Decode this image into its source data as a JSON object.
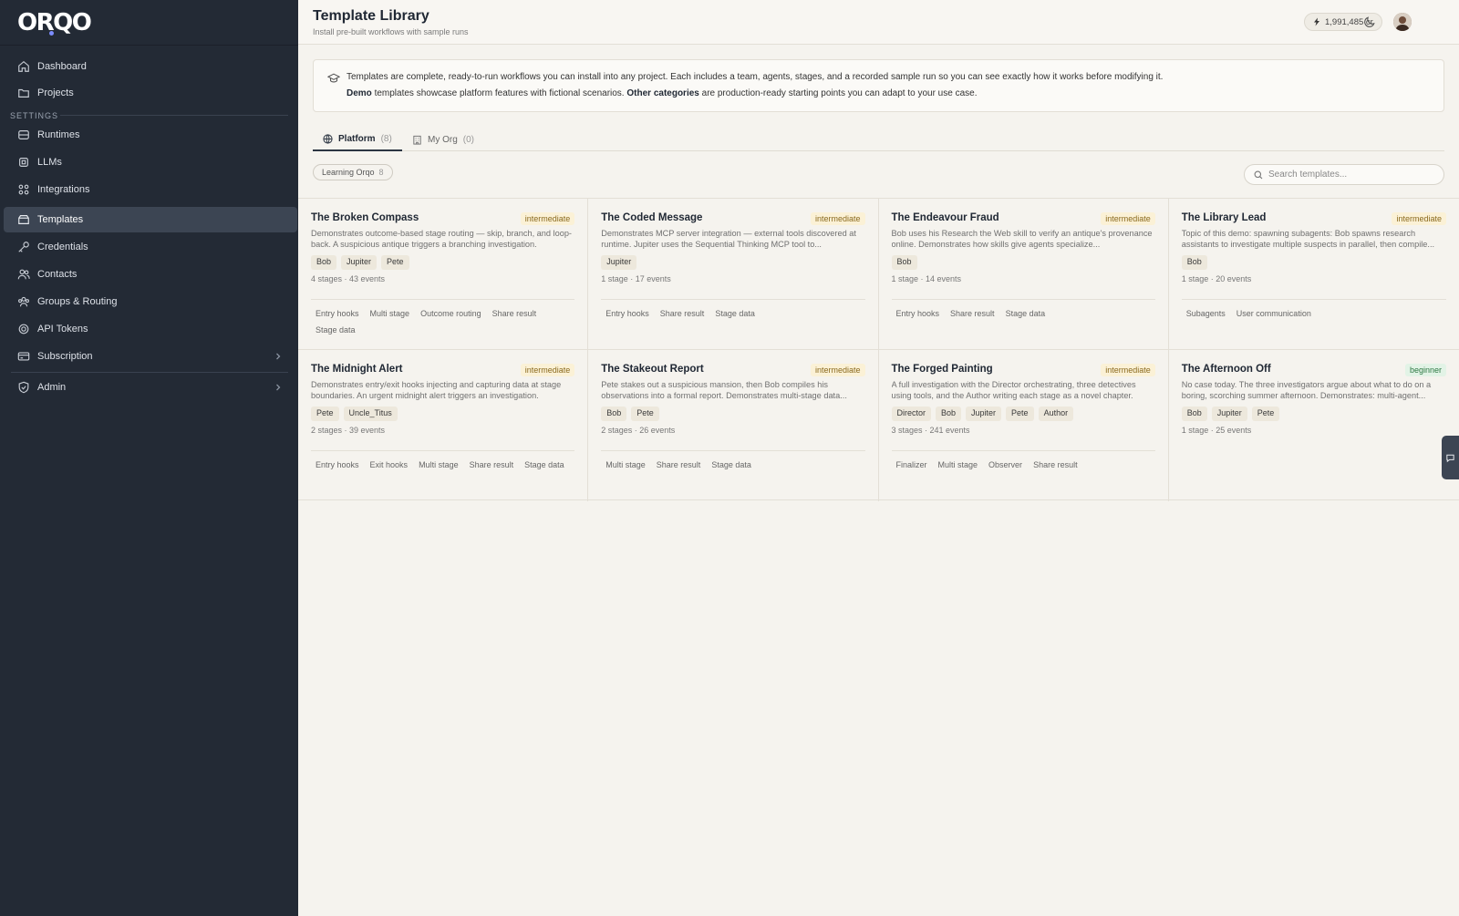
{
  "brand": {
    "logo_text": "ORQO"
  },
  "sidebar": {
    "items_top": [
      {
        "label": "Dashboard",
        "icon": "home-icon"
      },
      {
        "label": "Projects",
        "icon": "folder-icon"
      }
    ],
    "section_label": "SETTINGS",
    "items_settings": [
      {
        "label": "Runtimes",
        "icon": "database-icon"
      },
      {
        "label": "LLMs",
        "icon": "chip-icon"
      },
      {
        "label": "Integrations",
        "icon": "grid-icon"
      },
      {
        "label": "Templates",
        "icon": "box-icon",
        "active": true
      },
      {
        "label": "Credentials",
        "icon": "key-icon"
      },
      {
        "label": "Contacts",
        "icon": "users-icon"
      },
      {
        "label": "Groups & Routing",
        "icon": "group-icon"
      },
      {
        "label": "API Tokens",
        "icon": "token-icon"
      },
      {
        "label": "Subscription",
        "icon": "card-icon",
        "chevron": true
      }
    ],
    "admin": {
      "label": "Admin",
      "icon": "shield-icon",
      "chevron": true
    }
  },
  "header": {
    "title": "Template Library",
    "subtitle": "Install pre-built workflows with sample runs",
    "credits": "1,991,485 cr"
  },
  "banner": {
    "line1": "Templates are complete, ready-to-run workflows you can install into any project. Each includes a team, agents, stages, and a recorded sample run so you can see exactly how it works before modifying it.",
    "line2_bold1": "Demo",
    "line2_text1": " templates showcase platform features with fictional scenarios. ",
    "line2_bold2": "Other categories",
    "line2_text2": " are production-ready starting points you can adapt to your use case."
  },
  "tabs": [
    {
      "label": "Platform",
      "count": "(8)",
      "active": true
    },
    {
      "label": "My Org",
      "count": "(0)",
      "active": false
    }
  ],
  "filter": {
    "label": "Learning Orqo",
    "count": "8"
  },
  "search": {
    "placeholder": "Search templates..."
  },
  "cards": [
    {
      "title": "The Broken Compass",
      "level": "intermediate",
      "desc": "Demonstrates outcome-based stage routing — skip, branch, and loop-back. A suspicious antique triggers a branching investigation.",
      "agents": [
        "Bob",
        "Jupiter",
        "Pete"
      ],
      "stats": "4 stages · 43 events",
      "features": [
        "Entry hooks",
        "Multi stage",
        "Outcome routing",
        "Share result",
        "Stage data"
      ]
    },
    {
      "title": "The Coded Message",
      "level": "intermediate",
      "desc": "Demonstrates MCP server integration — external tools discovered at runtime. Jupiter uses the Sequential Thinking MCP tool to...",
      "agents": [
        "Jupiter"
      ],
      "stats": "1 stage · 17 events",
      "features": [
        "Entry hooks",
        "Share result",
        "Stage data"
      ]
    },
    {
      "title": "The Endeavour Fraud",
      "level": "intermediate",
      "desc": "Bob uses his Research the Web skill to verify an antique's provenance online. Demonstrates how skills give agents specialize...",
      "agents": [
        "Bob"
      ],
      "stats": "1 stage · 14 events",
      "features": [
        "Entry hooks",
        "Share result",
        "Stage data"
      ]
    },
    {
      "title": "The Library Lead",
      "level": "intermediate",
      "desc": "Topic of this demo: spawning subagents: Bob spawns research assistants to investigate multiple suspects in parallel, then compile...",
      "agents": [
        "Bob"
      ],
      "stats": "1 stage · 20 events",
      "features": [
        "Subagents",
        "User communication"
      ]
    },
    {
      "title": "The Midnight Alert",
      "level": "intermediate",
      "desc": "Demonstrates entry/exit hooks injecting and capturing data at stage boundaries. An urgent midnight alert triggers an investigation.",
      "agents": [
        "Pete",
        "Uncle_Titus"
      ],
      "stats": "2 stages · 39 events",
      "features": [
        "Entry hooks",
        "Exit hooks",
        "Multi stage",
        "Share result",
        "Stage data"
      ]
    },
    {
      "title": "The Stakeout Report",
      "level": "intermediate",
      "desc": "Pete stakes out a suspicious mansion, then Bob compiles his observations into a formal report. Demonstrates multi-stage data...",
      "agents": [
        "Bob",
        "Pete"
      ],
      "stats": "2 stages · 26 events",
      "features": [
        "Multi stage",
        "Share result",
        "Stage data"
      ]
    },
    {
      "title": "The Forged Painting",
      "level": "intermediate",
      "desc": "A full investigation with the Director orchestrating, three detectives using tools, and the Author writing each stage as a novel chapter.",
      "agents": [
        "Director",
        "Bob",
        "Jupiter",
        "Pete",
        "Author"
      ],
      "stats": "3 stages · 241 events",
      "features": [
        "Finalizer",
        "Multi stage",
        "Observer",
        "Share result"
      ]
    },
    {
      "title": "The Afternoon Off",
      "level": "beginner",
      "desc": "No case today. The three investigators argue about what to do on a boring, scorching summer afternoon. Demonstrates: multi-agent...",
      "agents": [
        "Bob",
        "Jupiter",
        "Pete"
      ],
      "stats": "1 stage · 25 events",
      "features": []
    }
  ]
}
